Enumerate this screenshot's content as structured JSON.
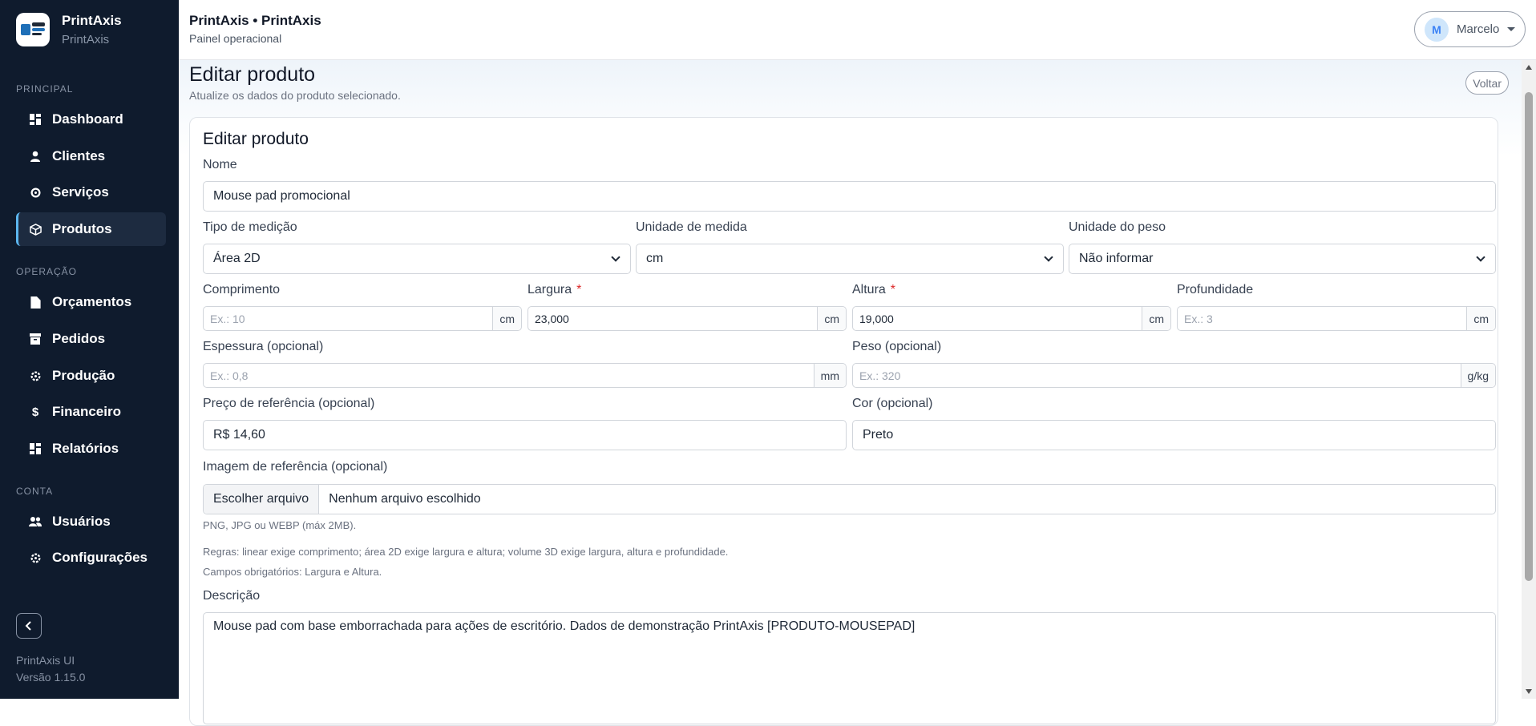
{
  "brand": {
    "title": "PrintAxis",
    "subtitle": "PrintAxis"
  },
  "sidebar": {
    "sections": [
      {
        "label": "PRINCIPAL"
      },
      {
        "label": "OPERAÇÃO"
      },
      {
        "label": "CONTA"
      }
    ],
    "items": [
      {
        "label": "Dashboard",
        "icon": "dashboard-icon"
      },
      {
        "label": "Clientes",
        "icon": "user-icon"
      },
      {
        "label": "Serviços",
        "icon": "gear-icon"
      },
      {
        "label": "Produtos",
        "icon": "box-icon",
        "active": true
      },
      {
        "label": "Orçamentos",
        "icon": "document-icon"
      },
      {
        "label": "Pedidos",
        "icon": "archive-icon"
      },
      {
        "label": "Produção",
        "icon": "gear-icon"
      },
      {
        "label": "Financeiro",
        "icon": "dollar-icon"
      },
      {
        "label": "Relatórios",
        "icon": "dashboard-icon"
      },
      {
        "label": "Usuários",
        "icon": "users-icon"
      },
      {
        "label": "Configurações",
        "icon": "gear-icon"
      }
    ],
    "footer": {
      "app": "PrintAxis UI",
      "version": "Versão 1.15.0"
    }
  },
  "header": {
    "title": "PrintAxis • PrintAxis",
    "subtitle": "Painel operacional",
    "user": {
      "initial": "M",
      "name": "Marcelo"
    }
  },
  "page": {
    "title": "Editar produto",
    "subtitle": "Atualize os dados do produto selecionado.",
    "back_label": "Voltar"
  },
  "form": {
    "card_title": "Editar produto",
    "nome": {
      "label": "Nome",
      "value": "Mouse pad promocional"
    },
    "tipo_medicao": {
      "label": "Tipo de medição",
      "value": "Área 2D"
    },
    "unidade_medida": {
      "label": "Unidade de medida",
      "value": "cm"
    },
    "unidade_peso": {
      "label": "Unidade do peso",
      "value": "Não informar"
    },
    "comprimento": {
      "label": "Comprimento",
      "placeholder": "Ex.: 10",
      "unit": "cm"
    },
    "largura": {
      "label": "Largura",
      "required": "*",
      "value": "23,000",
      "unit": "cm"
    },
    "altura": {
      "label": "Altura",
      "required": "*",
      "value": "19,000",
      "unit": "cm"
    },
    "profundidade": {
      "label": "Profundidade",
      "placeholder": "Ex.: 3",
      "unit": "cm"
    },
    "espessura": {
      "label": "Espessura (opcional)",
      "placeholder": "Ex.: 0,8",
      "unit": "mm"
    },
    "peso": {
      "label": "Peso (opcional)",
      "placeholder": "Ex.: 320",
      "unit": "g/kg"
    },
    "preco": {
      "label": "Preço de referência (opcional)",
      "value": "R$ 14,60"
    },
    "cor": {
      "label": "Cor (opcional)",
      "value": "Preto"
    },
    "imagem": {
      "label": "Imagem de referência (opcional)",
      "button": "Escolher arquivo",
      "file_name": "Nenhum arquivo escolhido",
      "hint": "PNG, JPG ou WEBP (máx 2MB)."
    },
    "rules": "Regras: linear exige comprimento; área 2D exige largura e altura; volume 3D exige largura, altura e profundidade.",
    "required_fields": "Campos obrigatórios: Largura e Altura.",
    "descricao": {
      "label": "Descrição",
      "value": "Mouse pad com base emborrachada para ações de escritório. Dados de demonstração PrintAxis [PRODUTO-MOUSEPAD]"
    }
  },
  "colors": {
    "sidebar_bg": "#0f1b2d",
    "active_item_bg": "#1d2b40",
    "accent": "#5cb7f0",
    "required": "#dc2626"
  }
}
